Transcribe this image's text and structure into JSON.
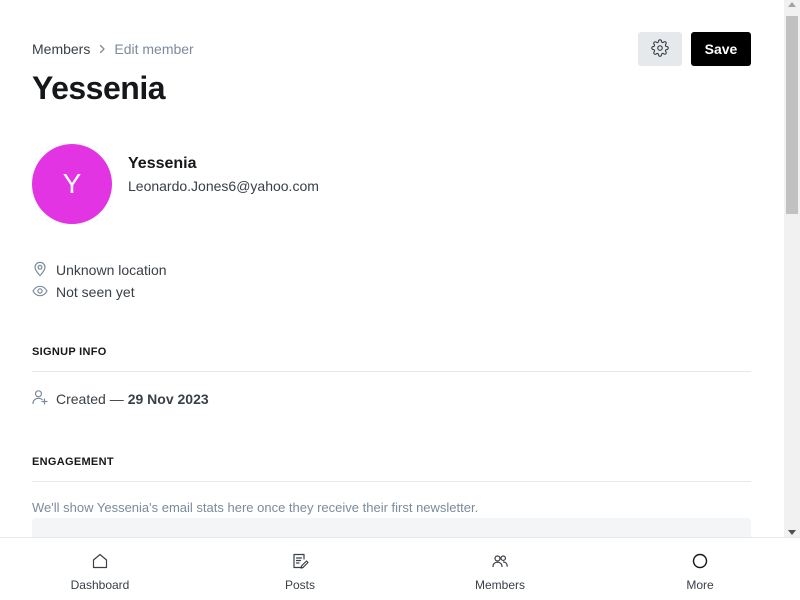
{
  "breadcrumb": {
    "parent": "Members",
    "current": "Edit member"
  },
  "header": {
    "save_label": "Save"
  },
  "page": {
    "title": "Yessenia"
  },
  "member": {
    "avatar_initial": "Y",
    "avatar_color": "#e234e2",
    "name": "Yessenia",
    "email": "Leonardo.Jones6@yahoo.com",
    "location": "Unknown location",
    "last_seen": "Not seen yet"
  },
  "signup": {
    "section_title": "SIGNUP INFO",
    "created_label": "Created —",
    "created_date": "29 Nov 2023"
  },
  "engagement": {
    "section_title": "ENGAGEMENT",
    "note": "We'll show Yessenia's email stats here once they receive their first newsletter."
  },
  "nav": {
    "items": [
      {
        "label": "Dashboard",
        "icon": "home-icon"
      },
      {
        "label": "Posts",
        "icon": "posts-icon"
      },
      {
        "label": "Members",
        "icon": "members-icon"
      },
      {
        "label": "More",
        "icon": "circle-icon"
      }
    ]
  },
  "icons": {
    "settings": "gear-icon",
    "breadcrumb_separator": "chevron-right-icon",
    "location": "location-pin-icon",
    "last_seen": "eye-icon",
    "created": "user-add-icon"
  },
  "colors": {
    "accent": "#e234e2",
    "primary_button": "#000000"
  }
}
